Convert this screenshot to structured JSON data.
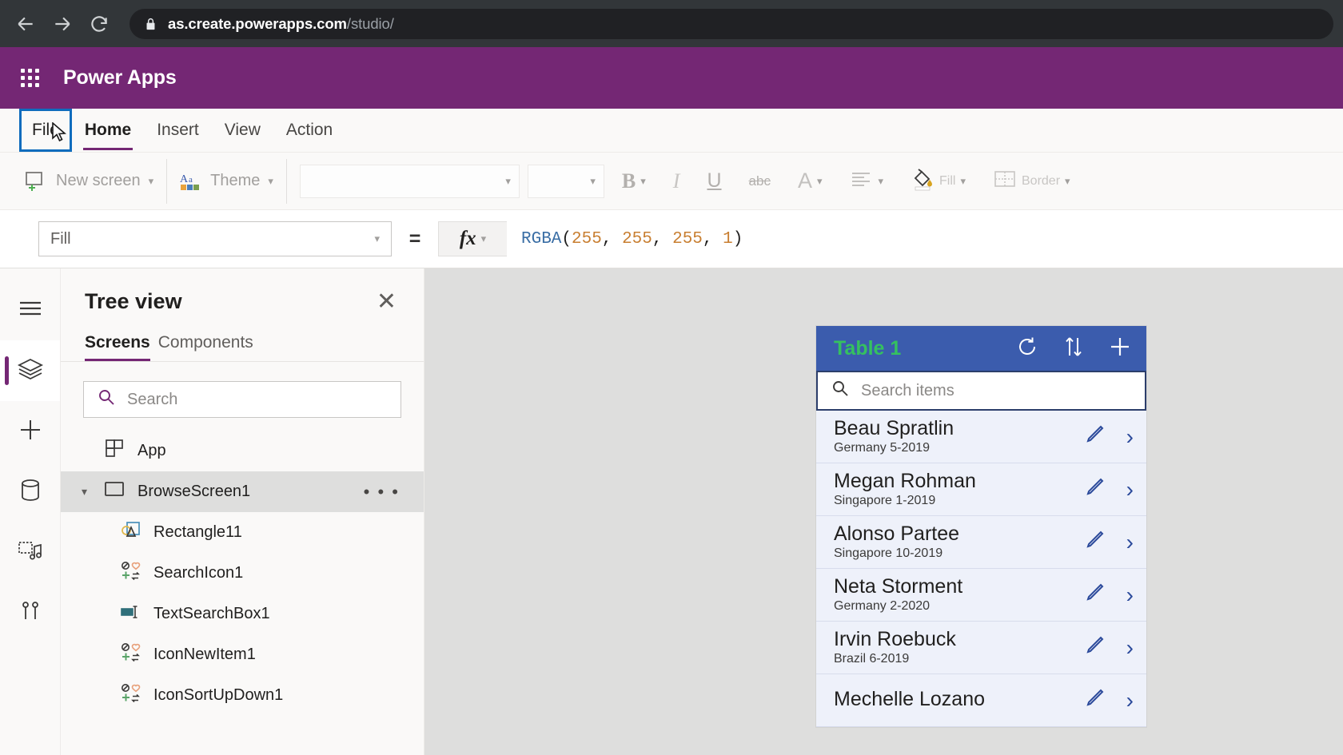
{
  "browser": {
    "back_icon": "arrow-left-icon",
    "forward_icon": "arrow-right-icon",
    "reload_icon": "reload-icon",
    "lock_icon": "lock-icon",
    "url_domain": "as.create.powerapps.com",
    "url_path": "/studio/"
  },
  "header": {
    "waffle_icon": "app-launcher-icon",
    "title": "Power Apps"
  },
  "menubar": {
    "items": [
      {
        "label": "File",
        "state": "focused"
      },
      {
        "label": "Home",
        "state": "active"
      },
      {
        "label": "Insert",
        "state": "normal"
      },
      {
        "label": "View",
        "state": "normal"
      },
      {
        "label": "Action",
        "state": "normal"
      }
    ]
  },
  "ribbon": {
    "new_screen": "New screen",
    "theme": "Theme",
    "font_family_value": "",
    "font_size_value": "",
    "bold": "B",
    "italic": "I",
    "underline": "U",
    "strikethrough": "abc",
    "font_color": "A",
    "align": "align-left-icon",
    "fill": "Fill",
    "border": "Border"
  },
  "formulabar": {
    "property": "Fill",
    "equals": "=",
    "fx": "fx",
    "formula": {
      "function": "RGBA",
      "open": "(",
      "args": [
        "255",
        "255",
        "255",
        "1"
      ],
      "close": ")",
      "full_text": "RGBA(255, 255, 255, 1)"
    }
  },
  "rail": {
    "items": [
      {
        "name": "hamburger-menu-icon",
        "active": false
      },
      {
        "name": "tree-view-icon",
        "active": true
      },
      {
        "name": "insert-plus-icon",
        "active": false
      },
      {
        "name": "data-cylinder-icon",
        "active": false
      },
      {
        "name": "media-icon",
        "active": false
      },
      {
        "name": "advanced-tools-icon",
        "active": false
      }
    ]
  },
  "treeview": {
    "title": "Tree view",
    "close_icon": "close-icon",
    "tabs": [
      {
        "label": "Screens",
        "active": true
      },
      {
        "label": "Components",
        "active": false
      }
    ],
    "search_placeholder": "Search",
    "items": [
      {
        "label": "App",
        "icon": "app-icon",
        "level": 0,
        "selected": false,
        "expandable": false
      },
      {
        "label": "BrowseScreen1",
        "icon": "screen-icon",
        "level": 0,
        "selected": true,
        "expandable": true,
        "overflow": "• • •"
      },
      {
        "label": "Rectangle11",
        "icon": "shape-icon",
        "level": 1,
        "selected": false,
        "expandable": false
      },
      {
        "label": "SearchIcon1",
        "icon": "icon-control-icon",
        "level": 1,
        "selected": false,
        "expandable": false
      },
      {
        "label": "TextSearchBox1",
        "icon": "text-input-icon",
        "level": 1,
        "selected": false,
        "expandable": false
      },
      {
        "label": "IconNewItem1",
        "icon": "icon-control-icon",
        "level": 1,
        "selected": false,
        "expandable": false
      },
      {
        "label": "IconSortUpDown1",
        "icon": "icon-control-icon",
        "level": 1,
        "selected": false,
        "expandable": false
      }
    ]
  },
  "gallery": {
    "title": "Table 1",
    "title_color": "#35c15f",
    "header_color": "#3b5cad",
    "actions": [
      {
        "name": "refresh-icon"
      },
      {
        "name": "sort-icon"
      },
      {
        "name": "add-icon"
      }
    ],
    "search_placeholder": "Search items",
    "search_icon": "search-icon",
    "edit_icon": "edit-pencil-icon",
    "chevron_icon": "chevron-right-icon",
    "chevron_glyph": "›",
    "rows": [
      {
        "name": "Beau Spratlin",
        "sub": "Germany 5-2019"
      },
      {
        "name": "Megan Rohman",
        "sub": "Singapore 1-2019"
      },
      {
        "name": "Alonso Partee",
        "sub": "Singapore 10-2019"
      },
      {
        "name": "Neta Storment",
        "sub": "Germany 2-2020"
      },
      {
        "name": "Irvin Roebuck",
        "sub": "Brazil 6-2019"
      },
      {
        "name": "Mechelle Lozano",
        "sub": ""
      }
    ]
  }
}
